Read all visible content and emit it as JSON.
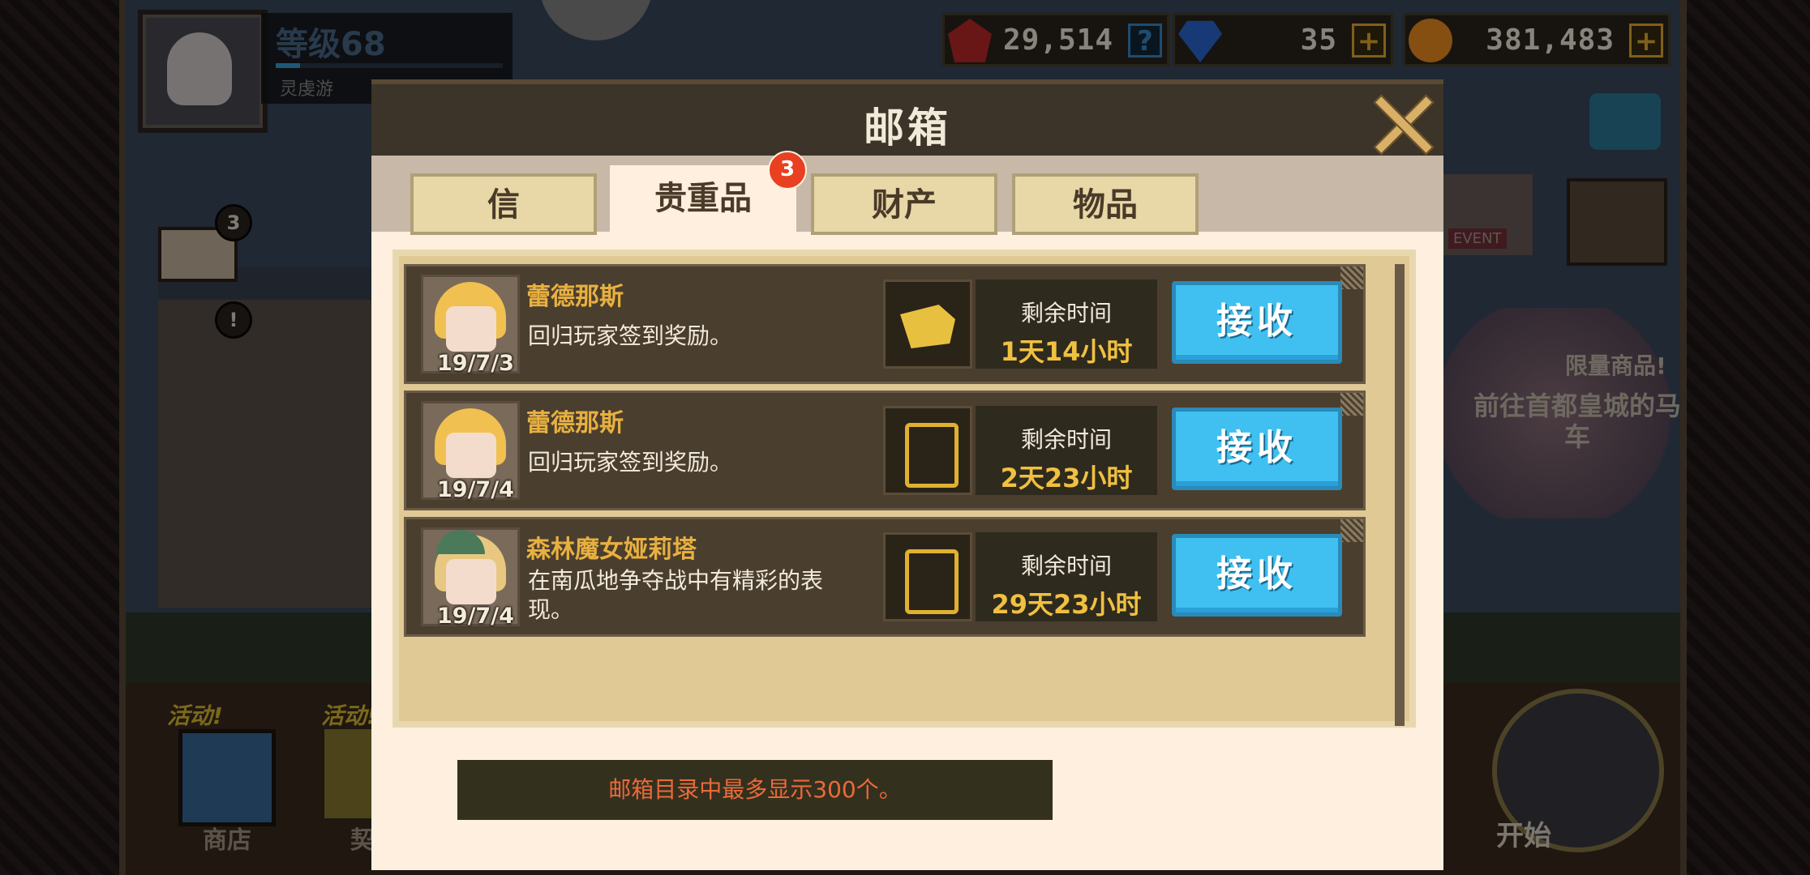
{
  "hud": {
    "level": "等级68",
    "player_name": "灵虔游",
    "currencies": [
      {
        "icon": "medal-icon",
        "value": "29,514",
        "button": "?"
      },
      {
        "icon": "gem-icon",
        "value": "35",
        "button": "+"
      },
      {
        "icon": "coin-icon",
        "value": "381,483",
        "button": "+"
      }
    ]
  },
  "side": {
    "mail_badge": "3",
    "alert_badge": "!",
    "event_label": "EVENT",
    "limited": "限量商品!",
    "goto_carriage": "前往首都皇城的马车",
    "start": "开始",
    "activity1": "活动!",
    "activity2": "活动!",
    "shop": "商店",
    "contract": "契约"
  },
  "dialog": {
    "title": "邮箱",
    "tabs": [
      {
        "label": "信",
        "active": false
      },
      {
        "label": "贵重品",
        "active": true,
        "badge": "3"
      },
      {
        "label": "财产",
        "active": false
      },
      {
        "label": "物品",
        "active": false
      }
    ],
    "mails": [
      {
        "sender": "蕾德那斯",
        "date": "19/7/3",
        "message": "回归玩家签到奖励。",
        "reward_icon": "scroll-icon",
        "time_label": "剩余时间",
        "time_left": "1天14小时",
        "button": "接收"
      },
      {
        "sender": "蕾德那斯",
        "date": "19/7/4",
        "message": "回归玩家签到奖励。",
        "reward_icon": "card-icon",
        "time_label": "剩余时间",
        "time_left": "2天23小时",
        "button": "接收"
      },
      {
        "sender": "森林魔女娅莉塔",
        "date": "19/7/4",
        "message": "在南瓜地争夺战中有精彩的表现。",
        "reward_icon": "card-icon",
        "time_label": "剩余时间",
        "time_left": "29天23小时",
        "button": "接收"
      }
    ],
    "notice": "邮箱目录中最多显示300个。"
  },
  "colors": {
    "accent_gold": "#f0c040",
    "button_blue": "#40c0f0",
    "notice_red": "#ea6a3a",
    "tab_badge": "#e84020"
  }
}
